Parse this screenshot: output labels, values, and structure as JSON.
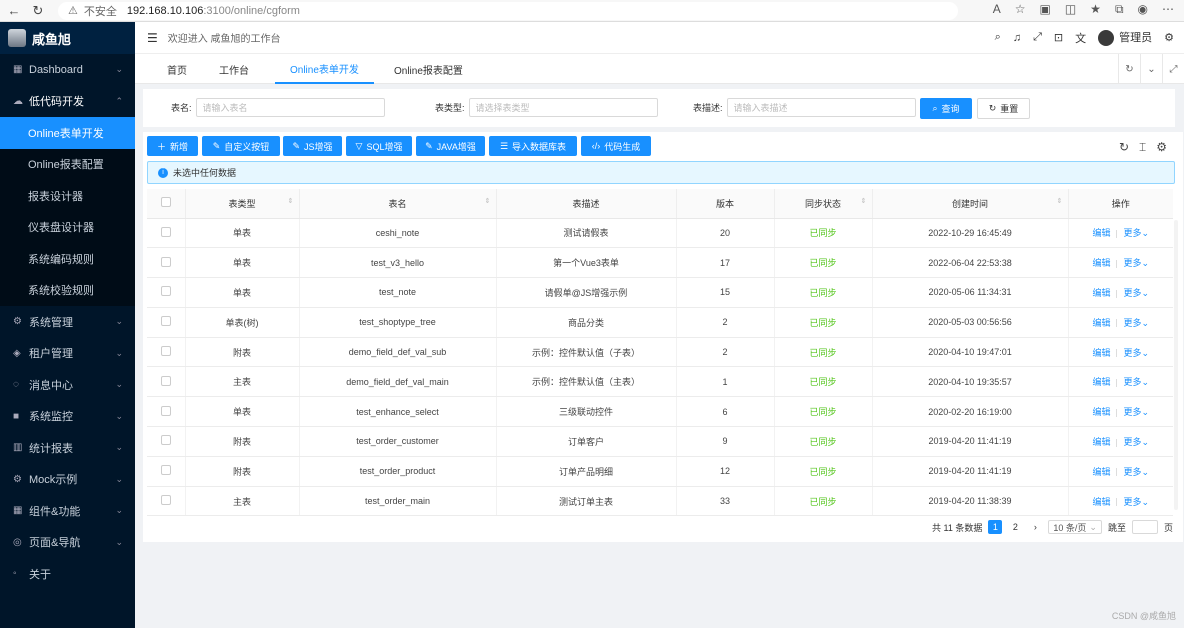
{
  "browser": {
    "insecure_label": "不安全",
    "url_host": "192.168.10.106",
    "url_path": ":3100/online/cgform"
  },
  "sidebar": {
    "brand": "咸鱼旭",
    "items": [
      {
        "label": "Dashboard",
        "icon": "appstore-icon"
      },
      {
        "label": "低代码开发",
        "icon": "cloud-icon"
      },
      {
        "label": "系统管理",
        "icon": "setting-icon"
      },
      {
        "label": "租户管理",
        "icon": "cluster-icon"
      },
      {
        "label": "消息中心",
        "icon": "message-icon"
      },
      {
        "label": "系统监控",
        "icon": "video-icon"
      },
      {
        "label": "统计报表",
        "icon": "bar-chart-icon"
      },
      {
        "label": "Mock示例",
        "icon": "setting-icon"
      },
      {
        "label": "组件&功能",
        "icon": "appstore-icon"
      },
      {
        "label": "页面&导航",
        "icon": "compass-icon"
      },
      {
        "label": "关于",
        "icon": "info-icon"
      }
    ],
    "submenu": [
      "Online表单开发",
      "Online报表配置",
      "报表设计器",
      "仪表盘设计器",
      "系统编码规则",
      "系统校验规则"
    ]
  },
  "header": {
    "welcome": "欢迎进入 咸鱼旭的工作台",
    "user": "管理员"
  },
  "tabs": [
    "首页",
    "工作台",
    "Online表单开发",
    "Online报表配置"
  ],
  "search": {
    "fields": [
      {
        "label": "表名:",
        "placeholder": "请输入表名"
      },
      {
        "label": "表类型:",
        "placeholder": "请选择表类型"
      },
      {
        "label": "表描述:",
        "placeholder": "请输入表描述"
      }
    ],
    "query_label": "查询",
    "reset_label": "重置"
  },
  "toolbar": [
    "新增",
    "自定义按钮",
    "JS增强",
    "SQL增强",
    "JAVA增强",
    "导入数据库表",
    "代码生成"
  ],
  "alert": "未选中任何数据",
  "table": {
    "columns": [
      "表类型",
      "表名",
      "表描述",
      "版本",
      "同步状态",
      "创建时间",
      "操作"
    ],
    "rows": [
      {
        "type": "单表",
        "name": "ceshi_note",
        "desc": "测试请假表",
        "version": "20",
        "status": "已同步",
        "created": "2022-10-29 16:45:49"
      },
      {
        "type": "单表",
        "name": "test_v3_hello",
        "desc": "第一个Vue3表单",
        "version": "17",
        "status": "已同步",
        "created": "2022-06-04 22:53:38"
      },
      {
        "type": "单表",
        "name": "test_note",
        "desc": "请假单@JS增强示例",
        "version": "15",
        "status": "已同步",
        "created": "2020-05-06 11:34:31"
      },
      {
        "type": "单表(树)",
        "name": "test_shoptype_tree",
        "desc": "商品分类",
        "version": "2",
        "status": "已同步",
        "created": "2020-05-03 00:56:56"
      },
      {
        "type": "附表",
        "name": "demo_field_def_val_sub",
        "desc": "示例：控件默认值（子表）",
        "version": "2",
        "status": "已同步",
        "created": "2020-04-10 19:47:01"
      },
      {
        "type": "主表",
        "name": "demo_field_def_val_main",
        "desc": "示例：控件默认值（主表）",
        "version": "1",
        "status": "已同步",
        "created": "2020-04-10 19:35:57"
      },
      {
        "type": "单表",
        "name": "test_enhance_select",
        "desc": "三级联动控件",
        "version": "6",
        "status": "已同步",
        "created": "2020-02-20 16:19:00"
      },
      {
        "type": "附表",
        "name": "test_order_customer",
        "desc": "订单客户",
        "version": "9",
        "status": "已同步",
        "created": "2019-04-20 11:41:19"
      },
      {
        "type": "附表",
        "name": "test_order_product",
        "desc": "订单产品明细",
        "version": "12",
        "status": "已同步",
        "created": "2019-04-20 11:41:19"
      },
      {
        "type": "主表",
        "name": "test_order_main",
        "desc": "测试订单主表",
        "version": "33",
        "status": "已同步",
        "created": "2019-04-20 11:38:39"
      }
    ],
    "edit_label": "编辑",
    "more_label": "更多"
  },
  "pagination": {
    "total": "共 11 条数据",
    "pages": [
      "1",
      "2"
    ],
    "page_size": "10 条/页",
    "jump_label": "跳至",
    "page_unit": "页"
  },
  "watermark": "CSDN @咸鱼旭",
  "colors": {
    "primary": "#1890ff",
    "sidebar": "#001529",
    "success": "#52c41a"
  }
}
